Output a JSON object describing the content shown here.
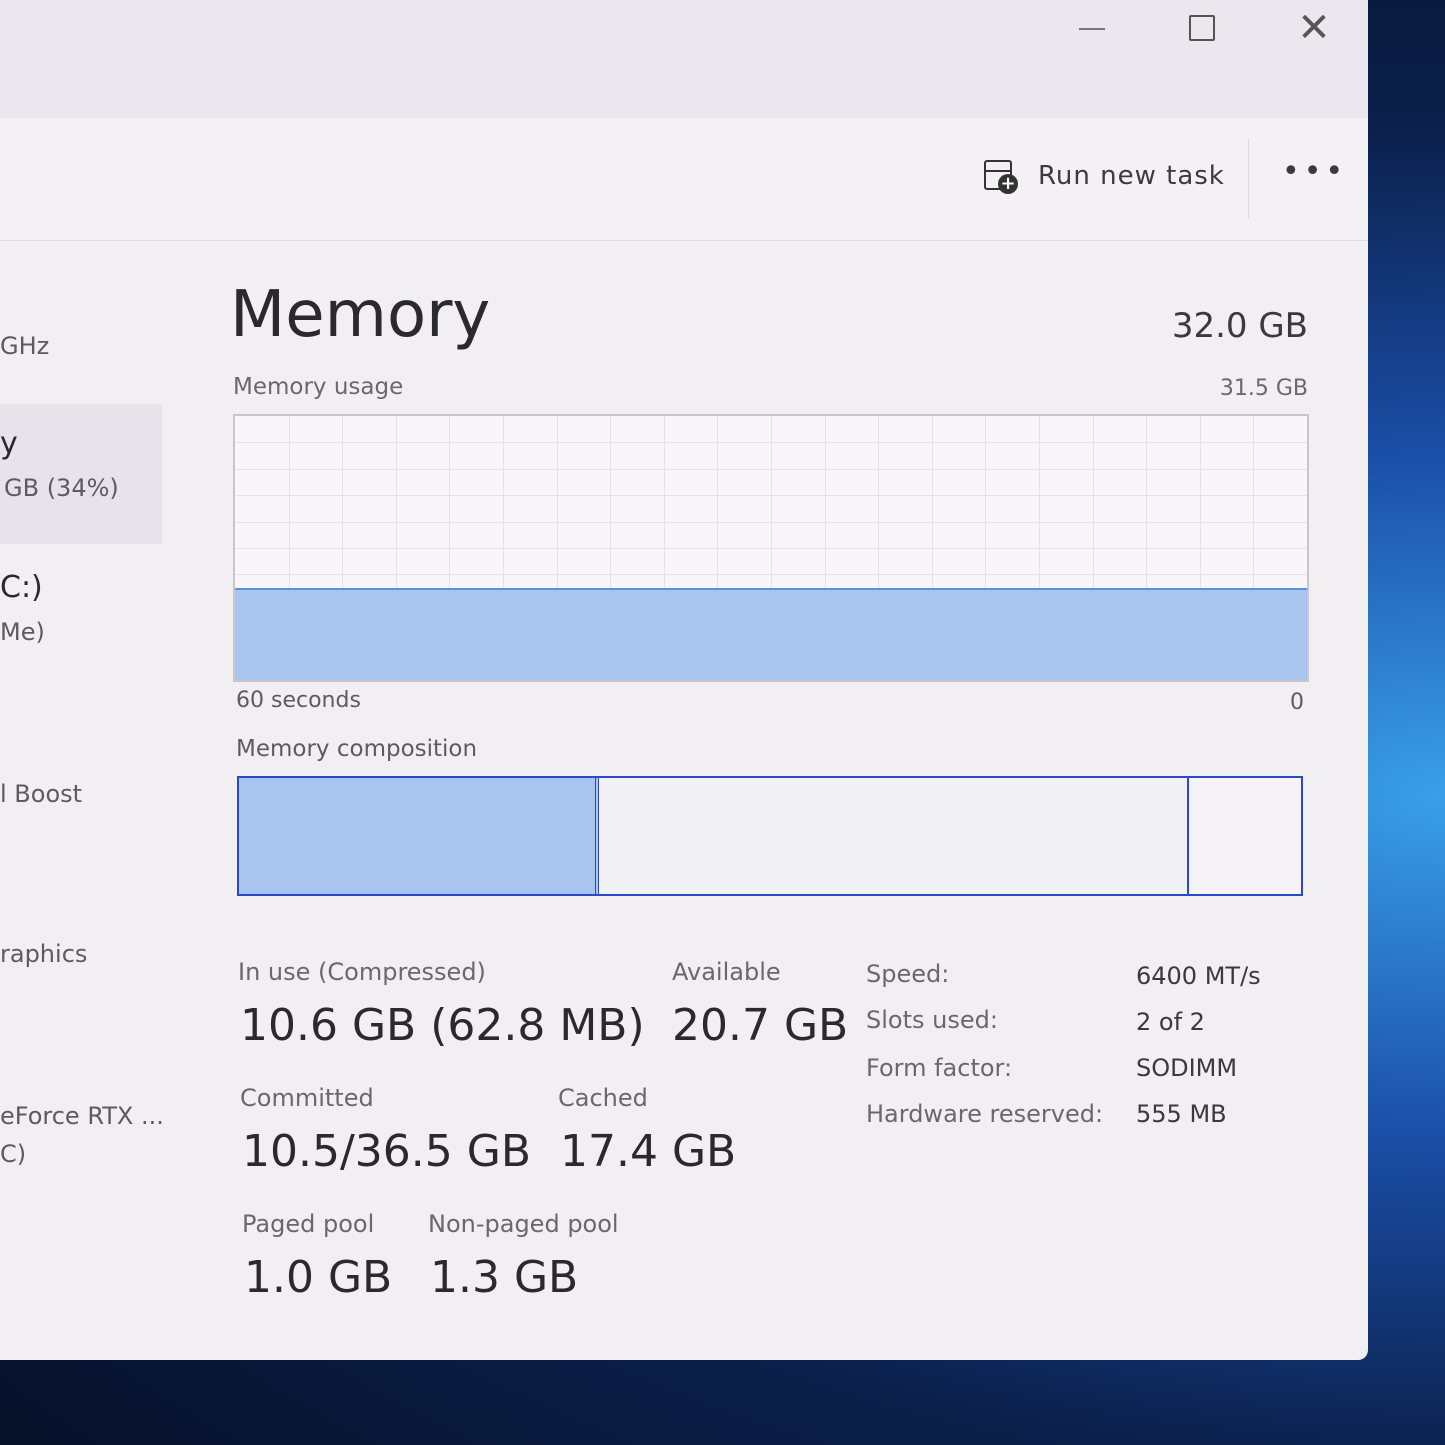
{
  "window_controls": {
    "minimize": "—",
    "maximize": "☐",
    "close": "✕"
  },
  "toolbar": {
    "run_new_task_label": "Run new task",
    "more_label": "•••",
    "run_icon": "run-task-icon"
  },
  "sidebar": {
    "items": [
      {
        "line1": "GHz"
      },
      {
        "line1": "y",
        "line2": "GB (34%)"
      },
      {
        "line1": "C:)",
        "line2": "Me)"
      },
      {
        "line1": "l Boost"
      },
      {
        "line1": "raphics"
      },
      {
        "line1": "eForce RTX ...",
        "line2": "C)"
      }
    ]
  },
  "memory": {
    "title": "Memory",
    "total": "32.0 GB",
    "usage_label": "Memory usage",
    "usage_max": "31.5 GB",
    "usage_fraction": 0.34,
    "time_left": "60 seconds",
    "time_right": "0",
    "composition_label": "Memory composition",
    "composition": {
      "in_use_gb": 10.6,
      "standby_gb": 17.4,
      "free_gb": 3.3
    },
    "stats": {
      "in_use_label": "In use (Compressed)",
      "in_use_value": "10.6 GB (62.8 MB)",
      "available_label": "Available",
      "available_value": "20.7 GB",
      "committed_label": "Committed",
      "committed_value": "10.5/36.5 GB",
      "cached_label": "Cached",
      "cached_value": "17.4 GB",
      "paged_pool_label": "Paged pool",
      "paged_pool_value": "1.0 GB",
      "nonpaged_pool_label": "Non-paged pool",
      "nonpaged_pool_value": "1.3 GB"
    },
    "details": [
      {
        "key": "Speed:",
        "value": "6400 MT/s"
      },
      {
        "key": "Slots used:",
        "value": "2 of 2"
      },
      {
        "key": "Form factor:",
        "value": "SODIMM"
      },
      {
        "key": "Hardware reserved:",
        "value": "555 MB"
      }
    ]
  },
  "colors": {
    "accent": "#2a49c9",
    "fill": "#a9c4ef"
  }
}
